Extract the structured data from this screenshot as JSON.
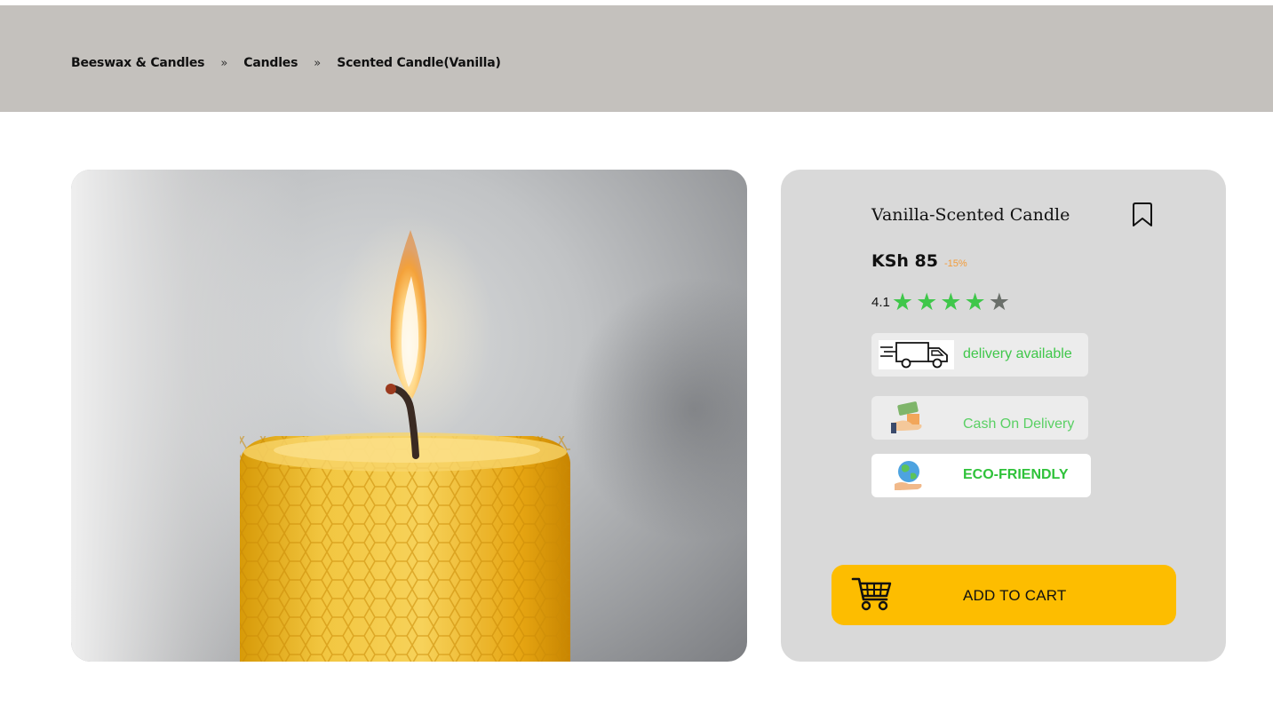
{
  "breadcrumb": {
    "items": [
      "Beeswax & Candles",
      "Candles",
      "Scented Candle(Vanilla)"
    ],
    "separator": "»"
  },
  "product": {
    "title": "Vanilla-Scented Candle",
    "price": "KSh 85",
    "discount": "-15%",
    "rating": "4.1",
    "rating_value": 4.1,
    "stars": {
      "filled": 4,
      "total": 5
    },
    "image_alt": "Beeswax honeycomb candle with lit wick"
  },
  "badges": {
    "delivery": "delivery available",
    "cod": "Cash On Delivery",
    "eco": "ECO-FRIENDLY"
  },
  "cart": {
    "label": "ADD TO CART"
  },
  "icons": {
    "bookmark": "bookmark-icon",
    "delivery": "truck-icon",
    "cod": "cash-hand-icon",
    "eco": "globe-hand-icon",
    "cart": "shopping-cart-icon",
    "star": "star-icon"
  },
  "colors": {
    "accent_yellow": "#fdbd00",
    "star_green": "#3fc74a",
    "discount_orange": "#f39c3a",
    "breadcrumb_bg": "#c4c1bd",
    "card_bg": "#d9d9d9"
  }
}
